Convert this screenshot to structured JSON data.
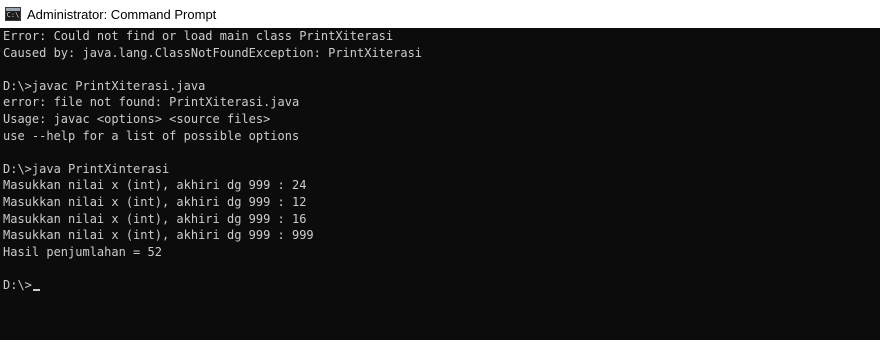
{
  "window": {
    "title": "Administrator: Command Prompt",
    "icon": "cmd-icon",
    "icon_glyph": "C:\\",
    "background_color": "#0c0c0c",
    "text_color": "#cccccc"
  },
  "console": {
    "lines": [
      "Error: Could not find or load main class PrintXiterasi",
      "Caused by: java.lang.ClassNotFoundException: PrintXiterasi",
      "",
      "D:\\>javac PrintXiterasi.java",
      "error: file not found: PrintXiterasi.java",
      "Usage: javac <options> <source files>",
      "use --help for a list of possible options",
      "",
      "D:\\>java PrintXinterasi",
      "Masukkan nilai x (int), akhiri dg 999 : 24",
      "Masukkan nilai x (int), akhiri dg 999 : 12",
      "Masukkan nilai x (int), akhiri dg 999 : 16",
      "Masukkan nilai x (int), akhiri dg 999 : 999",
      "Hasil penjumlahan = 52",
      ""
    ],
    "prompt": "D:\\>"
  }
}
